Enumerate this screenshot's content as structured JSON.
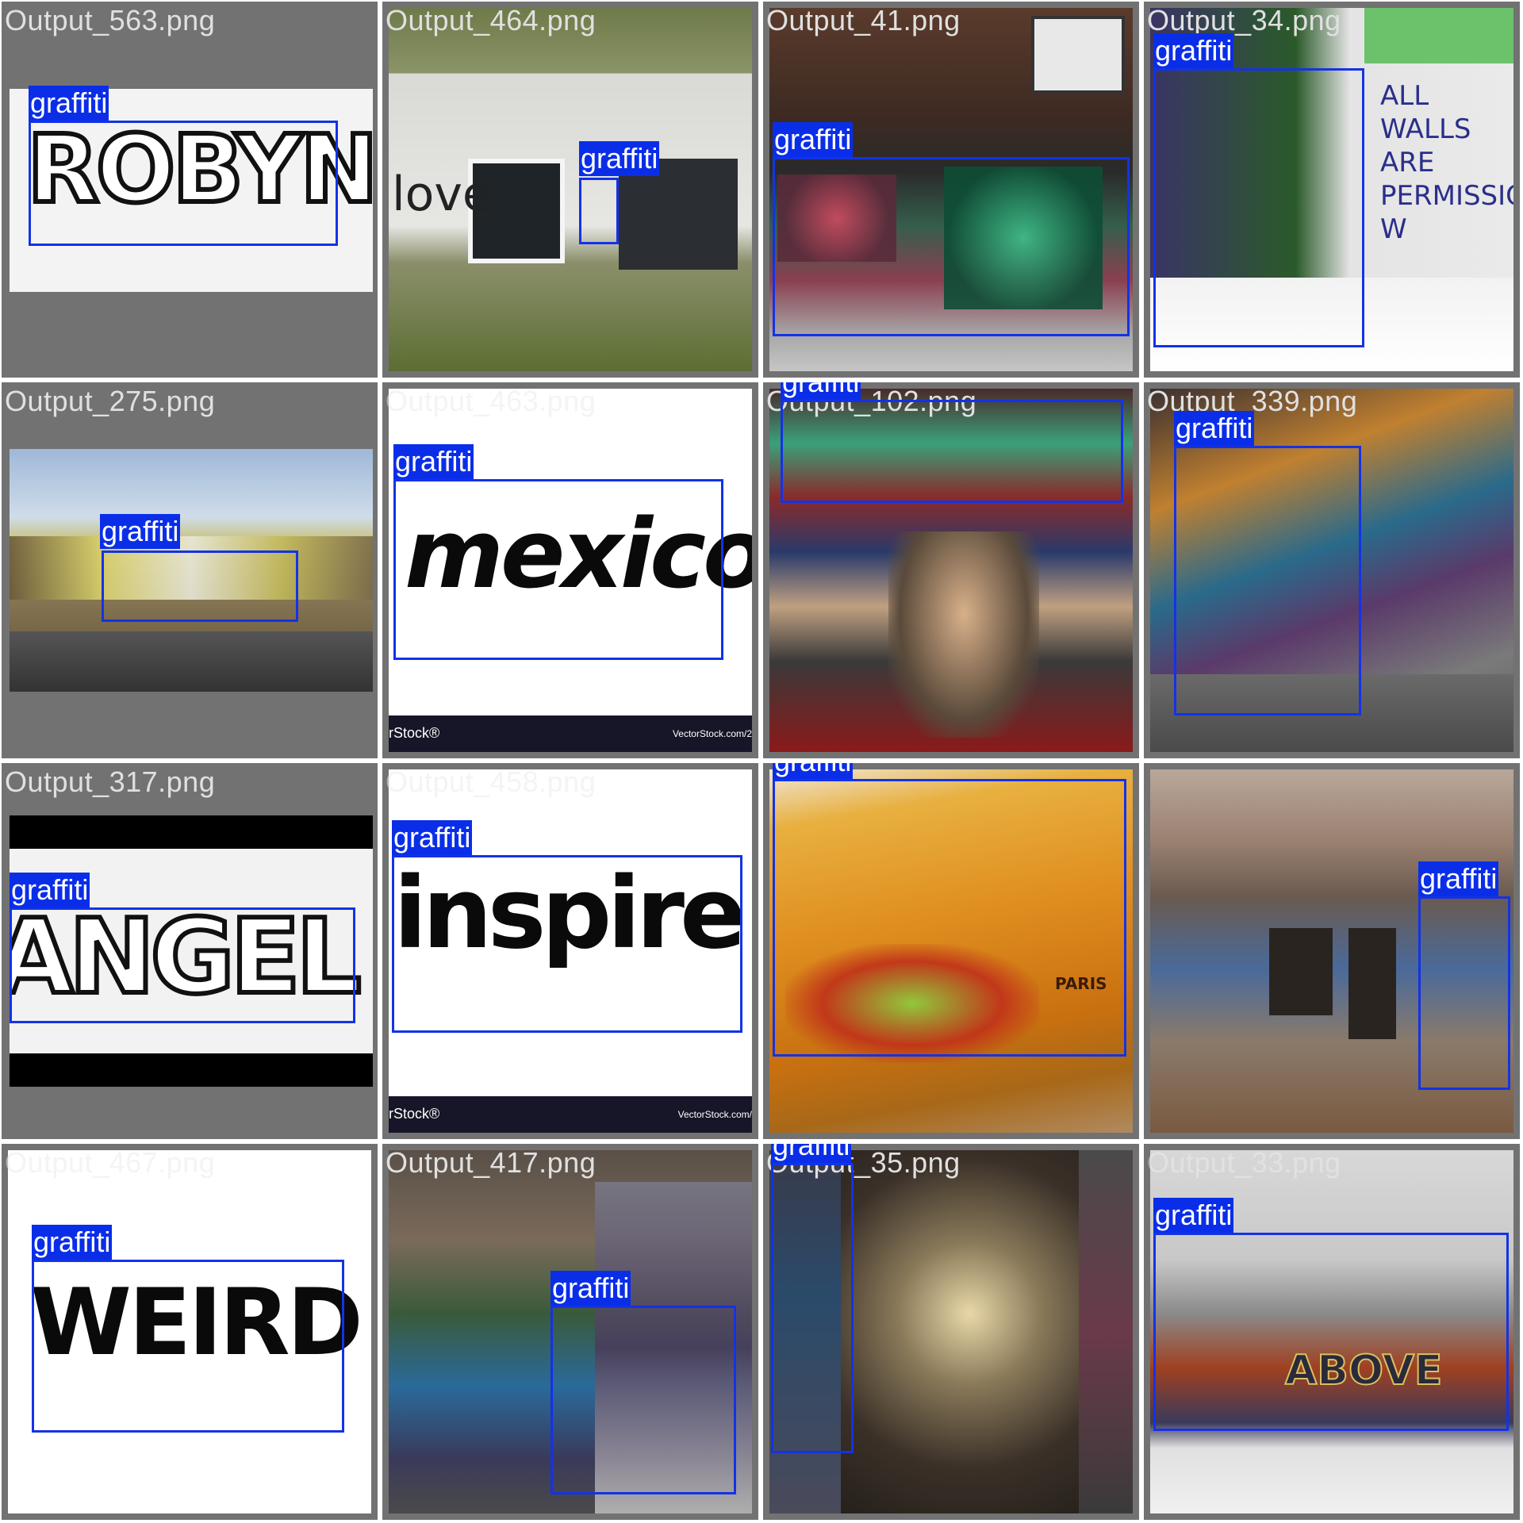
{
  "mosaic": {
    "tiles": [
      {
        "name": "Output_563.png",
        "faint": false,
        "label": "graffiti",
        "art_text": "ROBYN",
        "watermark": ""
      },
      {
        "name": "Output_464.png",
        "faint": false,
        "label": "graffiti",
        "art_text": "love",
        "watermark": ""
      },
      {
        "name": "Output_41.png",
        "faint": false,
        "label": "graffiti",
        "art_text": "",
        "watermark": ""
      },
      {
        "name": "Output_34.png",
        "faint": false,
        "label": "graffiti",
        "art_text": "ALL WALLS ARE PERMISSION W",
        "watermark": ""
      },
      {
        "name": "Output_275.png",
        "faint": false,
        "label": "graffiti",
        "art_text": "",
        "watermark": ""
      },
      {
        "name": "Output_463.png",
        "faint": true,
        "label": "graffiti",
        "art_text": "mexico",
        "watermark": "rStock®",
        "watermark_right": "VectorStock.com/2"
      },
      {
        "name": "Output_102.png",
        "faint": false,
        "label": "graffiti",
        "art_text": "",
        "watermark": ""
      },
      {
        "name": "Output_339.png",
        "faint": false,
        "label": "graffiti",
        "art_text": "",
        "watermark": ""
      },
      {
        "name": "Output_317.png",
        "faint": false,
        "label": "graffiti",
        "art_text": "ANGEL",
        "watermark": ""
      },
      {
        "name": "Output_458.png",
        "faint": true,
        "label": "graffiti",
        "art_text": "inspire",
        "watermark": "rStock®",
        "watermark_right": "VectorStock.com/"
      },
      {
        "name": "",
        "faint": true,
        "label": "graffiti",
        "art_text": "PARIS",
        "watermark": ""
      },
      {
        "name": "",
        "faint": true,
        "label": "graffiti",
        "art_text": "",
        "watermark": ""
      },
      {
        "name": "Output_467.png",
        "faint": true,
        "label": "graffiti",
        "art_text": "WEIRD!",
        "watermark": ""
      },
      {
        "name": "Output_417.png",
        "faint": false,
        "label": "graffiti",
        "art_text": "",
        "watermark": ""
      },
      {
        "name": "Output_35.png",
        "faint": false,
        "label": "graffiti",
        "art_text": "",
        "watermark": ""
      },
      {
        "name": "Output_33.png",
        "faint": true,
        "label": "graffiti",
        "art_text": "ABOVE",
        "watermark": ""
      }
    ]
  }
}
